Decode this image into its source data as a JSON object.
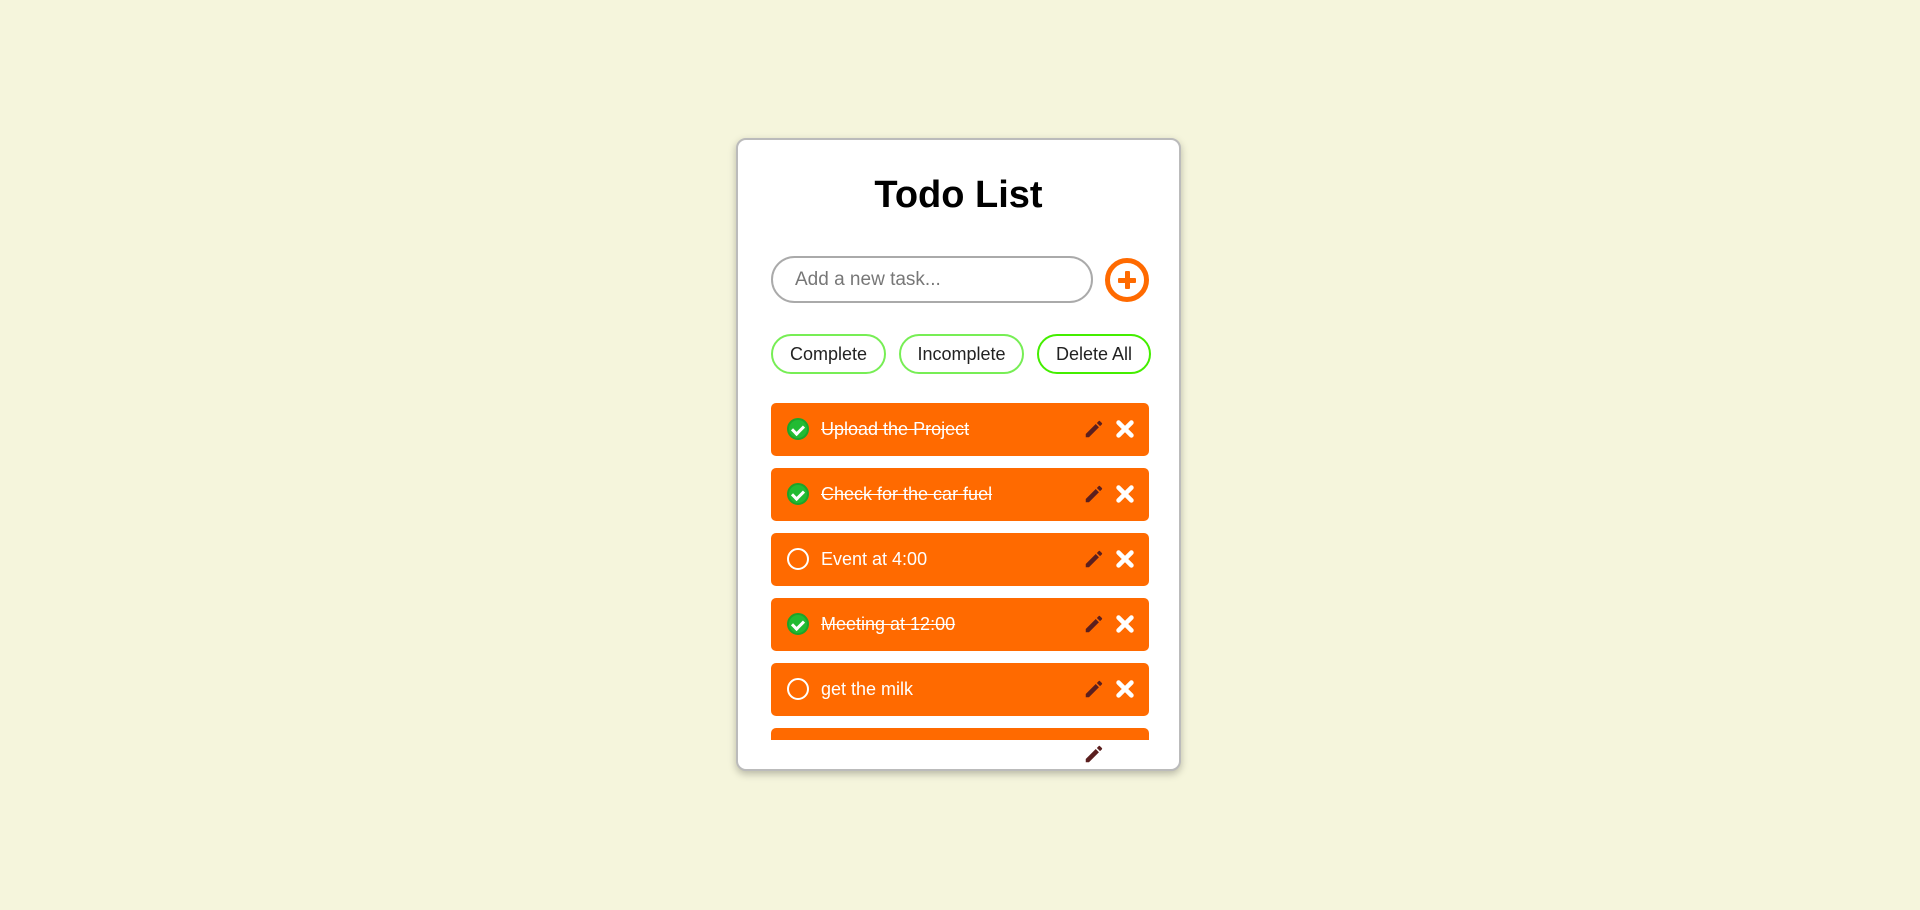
{
  "app": {
    "title": "Todo List"
  },
  "input": {
    "placeholder": "Add a new task...",
    "value": ""
  },
  "filters": {
    "complete": "Complete",
    "incomplete": "Incomplete",
    "delete_all": "Delete All"
  },
  "colors": {
    "background": "#f5f5dc",
    "accent": "#ff6a00",
    "filter_border": "#77ee55",
    "done_check": "#22bb33",
    "pencil": "#5a1f1f"
  },
  "tasks": [
    {
      "text": "Upload the Project",
      "done": true
    },
    {
      "text": "Check for the car fuel",
      "done": true
    },
    {
      "text": "Event at 4:00",
      "done": false
    },
    {
      "text": "Meeting at 12:00",
      "done": true
    },
    {
      "text": "get the milk",
      "done": false
    }
  ]
}
